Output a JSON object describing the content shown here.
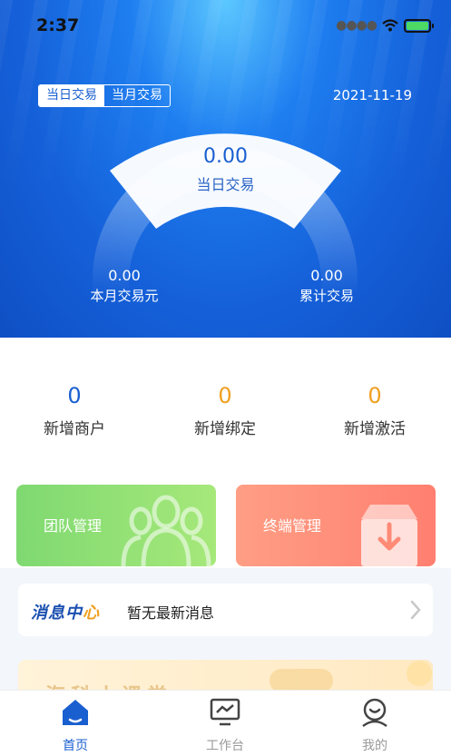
{
  "status_bar": {
    "time": "2:37"
  },
  "header": {
    "tabs": [
      {
        "label": "当日交易",
        "active": true
      },
      {
        "label": "当月交易",
        "active": false
      }
    ],
    "date": "2021-11-19"
  },
  "gauge": {
    "center_value": "0.00",
    "center_label": "当日交易",
    "left_value": "0.00",
    "left_label": "本月交易元",
    "right_value": "0.00",
    "right_label": "累计交易"
  },
  "counts": [
    {
      "value": "0",
      "label": "新增商户"
    },
    {
      "value": "0",
      "label": "新增绑定"
    },
    {
      "value": "0",
      "label": "新增激活"
    }
  ],
  "cards": {
    "team_label": "团队管理",
    "terminal_label": "终端管理"
  },
  "message": {
    "title_main": "消息中",
    "title_accent": "心",
    "text": "暂无最新消息"
  },
  "banner": {
    "text": "海科小课堂"
  },
  "tabbar": {
    "items": [
      {
        "label": "首页"
      },
      {
        "label": "工作台"
      },
      {
        "label": "我的"
      }
    ]
  },
  "colors": {
    "primary": "#1a5fd0",
    "orange": "#f0a020",
    "green": "#7fd971",
    "salmon": "#ff8e78"
  }
}
